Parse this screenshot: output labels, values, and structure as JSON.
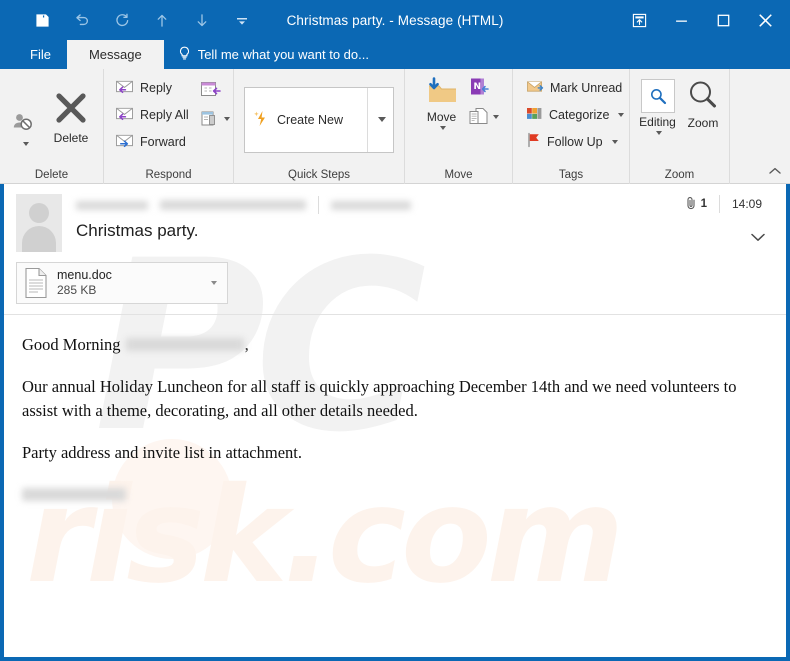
{
  "window": {
    "title": "Christmas party. - Message (HTML)",
    "accent_color": "#0b68b4",
    "quick_access": [
      {
        "name": "save-icon",
        "label": "Save"
      },
      {
        "name": "undo-icon",
        "label": "Undo"
      },
      {
        "name": "redo-icon",
        "label": "Redo"
      },
      {
        "name": "previous-item-icon",
        "label": "Previous Item"
      },
      {
        "name": "next-item-icon",
        "label": "Next Item"
      },
      {
        "name": "customize-quick-access-toolbar-icon",
        "label": "Customize Quick Access Toolbar"
      }
    ],
    "controls": [
      {
        "name": "ribbon-display-options-icon",
        "label": "Ribbon Display Options"
      },
      {
        "name": "minimize-icon",
        "label": "Minimize"
      },
      {
        "name": "maximize-icon",
        "label": "Maximize"
      },
      {
        "name": "close-icon",
        "label": "Close"
      }
    ]
  },
  "tabs": {
    "file": "File",
    "message": "Message",
    "tell_me": "Tell me what you want to do..."
  },
  "ribbon": {
    "groups": [
      {
        "label": "Delete",
        "buttons": [
          {
            "label": "Junk",
            "icon": "junk-icon"
          },
          {
            "label": "Delete",
            "icon": "delete-icon"
          }
        ]
      },
      {
        "label": "Respond",
        "buttons": [
          {
            "label": "Reply",
            "icon": "reply-icon"
          },
          {
            "label": "Reply All",
            "icon": "reply-all-icon"
          },
          {
            "label": "Forward",
            "icon": "forward-icon"
          },
          {
            "label": "Meeting",
            "icon": "meeting-icon"
          },
          {
            "label": "More",
            "icon": "more-respond-icon"
          }
        ]
      },
      {
        "label": "Quick Steps",
        "buttons": [
          {
            "label": "Create New",
            "icon": "create-new-icon"
          }
        ]
      },
      {
        "label": "Move",
        "buttons": [
          {
            "label": "Move",
            "icon": "move-folder-icon"
          },
          {
            "label": "OneNote",
            "icon": "onenote-icon"
          },
          {
            "label": "Rules",
            "icon": "rules-icon"
          }
        ]
      },
      {
        "label": "Tags",
        "buttons": [
          {
            "label": "Mark Unread",
            "icon": "mark-unread-icon"
          },
          {
            "label": "Categorize",
            "icon": "categorize-icon"
          },
          {
            "label": "Follow Up",
            "icon": "follow-up-flag-icon"
          }
        ]
      },
      {
        "label": "Zoom",
        "buttons": [
          {
            "label": "Editing",
            "icon": "editing-icon"
          },
          {
            "label": "Zoom",
            "icon": "zoom-magnifier-icon"
          }
        ]
      }
    ]
  },
  "message": {
    "sender_name": "",
    "sender_email": "",
    "recipient": "",
    "subject": "Christmas party.",
    "time": "14:09",
    "attachment_count": "1",
    "attachment": {
      "filename": "menu.doc",
      "size": "285 KB"
    },
    "body": {
      "greeting_prefix": "Good Morning ",
      "greeting_name": "",
      "greeting_suffix": ",",
      "paragraph_1": "Our annual Holiday Luncheon for all staff is quickly approaching December 14th and we need volunteers to assist with a theme, decorating, and all other details needed.",
      "paragraph_2": "Party address and invite list in attachment.",
      "signature": ""
    }
  },
  "watermark": {
    "top": "PC",
    "bottom": "risk.com"
  }
}
